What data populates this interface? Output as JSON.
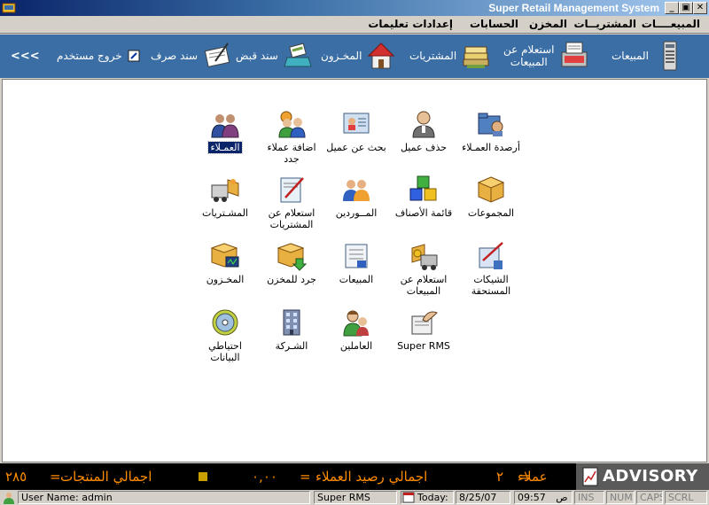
{
  "window": {
    "title": "Super Retail Management System"
  },
  "menu": [
    "المبيعــــات",
    "المشتريــات",
    "المخزن",
    "الحسابات",
    "إعدادات",
    "تعليمات"
  ],
  "toolbar": {
    "sales": "المبيعات",
    "sales_inquiry": "استعلام عن\nالمبيعات",
    "purchases": "المشتريات",
    "store": "المخـزون",
    "receipt": "سند قبض",
    "payment": "سند صرف",
    "logout": "خروج مستخدم",
    "more": "<<<"
  },
  "grid": [
    {
      "label": "أرصدة العمـلاء",
      "icon": "customer-balances-icon"
    },
    {
      "label": "حذف عميل",
      "icon": "delete-customer-icon"
    },
    {
      "label": "بحث عن عميل",
      "icon": "search-customer-icon"
    },
    {
      "label": "اضافة عملاء\nجدد",
      "icon": "add-customers-icon"
    },
    {
      "label": "العمـلاء",
      "icon": "customers-icon"
    },
    {
      "label": "المجموعات",
      "icon": "groups-icon"
    },
    {
      "label": "قائمة الأصناف",
      "icon": "items-list-icon"
    },
    {
      "label": "المــوردين",
      "icon": "suppliers-icon"
    },
    {
      "label": "استعلام عن\nالمشتريات",
      "icon": "purchases-inquiry-icon"
    },
    {
      "label": "المشـتريات",
      "icon": "purchases-icon"
    },
    {
      "label": "الشيكات\nالمستحقة",
      "icon": "due-checks-icon"
    },
    {
      "label": "استعلام عن\nالمبيعات",
      "icon": "sales-inquiry-icon"
    },
    {
      "label": "المبيعات",
      "icon": "sales-icon"
    },
    {
      "label": "جرد للمخزن",
      "icon": "inventory-count-icon"
    },
    {
      "label": "المخـزون",
      "icon": "store-icon"
    },
    {
      "label": "Super RMS",
      "icon": "super-rms-icon"
    },
    {
      "label": "العاملين",
      "icon": "employees-icon"
    },
    {
      "label": "الشـركة",
      "icon": "company-icon"
    },
    {
      "label": "احتياطي\nالبيانات",
      "icon": "backup-icon"
    }
  ],
  "summary": {
    "customers_label": "عملاء",
    "customers_value": "٢",
    "balance_label": "اجمالي رصيد العملاء",
    "balance_value": "٠,٠٠",
    "products_label": "اجمالي المنتجات",
    "products_value": "٢٨٥",
    "brand": "ADVISORY"
  },
  "status": {
    "user": "User Name:",
    "user_value": "admin",
    "app": "Super RMS",
    "today": "Today:",
    "date": "8/25/07",
    "time": "09:57",
    "ampm": "ص",
    "ins": "INS",
    "num": "NUM",
    "caps": "CAPS",
    "scrl": "SCRL"
  },
  "colors": {
    "title_bar": "#0a246a",
    "toolbar": "#3a6ea5",
    "summary_text": "#ff8c00",
    "selection": "#0a246a"
  }
}
